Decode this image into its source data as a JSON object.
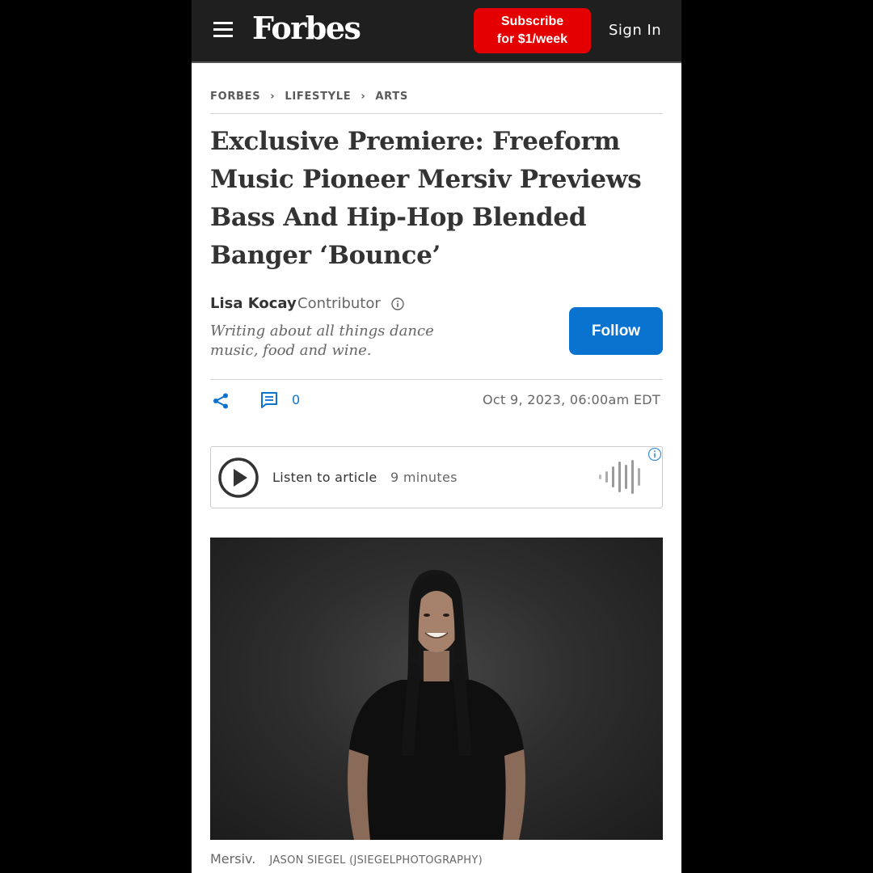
{
  "header": {
    "logo": "Forbes",
    "subscribe_line1": "Subscribe",
    "subscribe_line2": "for $1/week",
    "signin": "Sign In",
    "subscribe_color": "#e40000"
  },
  "breadcrumb": {
    "items": [
      "FORBES",
      "LIFESTYLE",
      "ARTS"
    ]
  },
  "article": {
    "title": "Exclusive Premiere: Freeform Music Pioneer Mersiv Previews Bass And Hip-Hop Blended Banger ‘Bounce’",
    "author": {
      "name": "Lisa Kocay",
      "role": "Contributor",
      "bio": "Writing about all things dance music, food and wine."
    },
    "follow_label": "Follow",
    "comment_count": "0",
    "published": "Oct 9, 2023, 06:00am EDT",
    "accent_color": "#0a72cf"
  },
  "audio": {
    "label": "Listen to article",
    "duration": "9 minutes"
  },
  "photo": {
    "caption": "Mersiv.",
    "credit": "JASON SIEGEL (JSIEGELPHOTOGRAPHY)"
  }
}
